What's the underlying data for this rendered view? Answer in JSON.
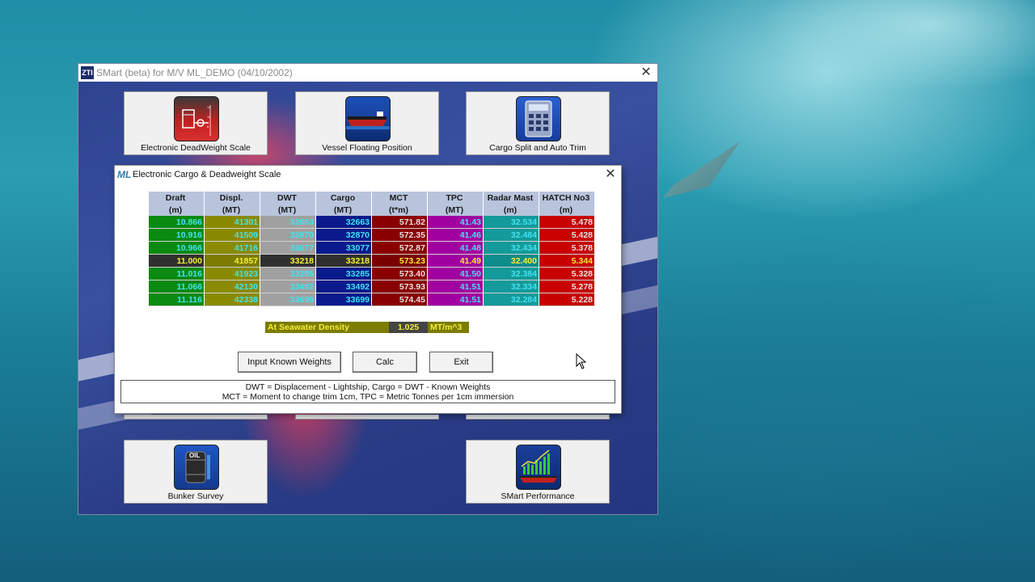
{
  "main_window": {
    "title": "SMart (beta) for M/V ML_DEMO (04/10/2002)",
    "app_icon_text": "ZTI",
    "tiles": [
      {
        "label": "Electronic DeadWeight Scale",
        "icon": "deadweight-scale-icon"
      },
      {
        "label": "Vessel Floating Position",
        "icon": "vessel-icon"
      },
      {
        "label": "Cargo Split and Auto Trim",
        "icon": "calculator-icon"
      },
      {
        "label": "Bunker Survey",
        "icon": "oil-barrel-icon",
        "icon_text": "OIL"
      },
      {
        "label": "SMart Performance",
        "icon": "performance-chart-icon"
      }
    ]
  },
  "dialog": {
    "title": "Electronic Cargo & Deadweight Scale",
    "icon_text": "ML",
    "columns": [
      {
        "name": "Draft",
        "unit": "(m)"
      },
      {
        "name": "Displ.",
        "unit": "(MT)"
      },
      {
        "name": "DWT",
        "unit": "(MT)"
      },
      {
        "name": "Cargo",
        "unit": "(MT)"
      },
      {
        "name": "MCT",
        "unit": "(t*m)"
      },
      {
        "name": "TPC",
        "unit": "(MT)"
      },
      {
        "name": "Radar Mast",
        "unit": "(m)"
      },
      {
        "name": "HATCH No3",
        "unit": "(m)"
      }
    ],
    "rows": [
      [
        "10.866",
        "41301",
        "32663",
        "32663",
        "571.82",
        "41.43",
        "32.534",
        "5.478"
      ],
      [
        "10.916",
        "41509",
        "32870",
        "32870",
        "572.35",
        "41.46",
        "32.484",
        "5.428"
      ],
      [
        "10.966",
        "41716",
        "33077",
        "33077",
        "572.87",
        "41.48",
        "32.434",
        "5.378"
      ],
      [
        "11.000",
        "41857",
        "33218",
        "33218",
        "573.23",
        "41.49",
        "32.400",
        "5.344"
      ],
      [
        "11.016",
        "41923",
        "33285",
        "33285",
        "573.40",
        "41.50",
        "32.384",
        "5.328"
      ],
      [
        "11.066",
        "42130",
        "33492",
        "33492",
        "573.93",
        "41.51",
        "32.334",
        "5.278"
      ],
      [
        "11.116",
        "42338",
        "33699",
        "33699",
        "574.45",
        "41.51",
        "32.284",
        "5.228"
      ]
    ],
    "selected_row": 3,
    "density": {
      "label": "At Seawater Density",
      "value": "1.025",
      "unit": "MT/m^3"
    },
    "buttons": {
      "input_known": "Input Known Weights",
      "calc": "Calc",
      "exit": "Exit"
    },
    "legend": {
      "line1": "DWT = Displacement - Lightship, Cargo = DWT - Known Weights",
      "line2": "MCT = Moment to change trim 1cm, TPC = Metric Tonnes per 1cm immersion"
    }
  },
  "colors": {
    "column_backgrounds": [
      "#0b8a12",
      "#8a8a00",
      "#a0a0a0",
      "#0a1a8c",
      "#8a0000",
      "#a000a0",
      "#149a9a",
      "#c80000"
    ],
    "cell_text": "#42e3f0",
    "selected_text": "#f5ee3a",
    "window_bg": "#2b3f86"
  }
}
